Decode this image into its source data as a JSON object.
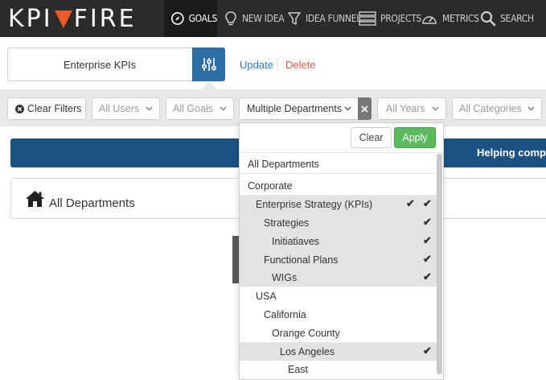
{
  "nav": {
    "logo_left": "KPI",
    "logo_right": "FIRE",
    "items": [
      {
        "label": "GOALS",
        "icon": "compass-icon",
        "active": true
      },
      {
        "label": "NEW IDEA",
        "icon": "lightbulb-icon"
      },
      {
        "label": "IDEA FUNNEL",
        "icon": "funnel-icon"
      },
      {
        "label": "PROJECTS",
        "icon": "projects-icon"
      },
      {
        "label": "METRICS",
        "icon": "speedometer-icon"
      },
      {
        "label": "SEARCH",
        "icon": "search-icon"
      }
    ]
  },
  "goal_bar": {
    "selected_goal": "Enterprise KPIs",
    "update_label": "Update",
    "delete_label": "Delete"
  },
  "filters": {
    "clear_filters_label": "Clear Filters",
    "users": "All Users",
    "goals": "All Goals",
    "departments": "Multiple Departments",
    "years": "All Years",
    "categories": "All Categories"
  },
  "banner": {
    "text": "Helping comp"
  },
  "department_card": {
    "title": "All Departments"
  },
  "dropdown": {
    "clear_label": "Clear",
    "apply_label": "Apply",
    "options": [
      {
        "label": "All Departments",
        "level": 0,
        "selected": false
      },
      {
        "label": "Corporate",
        "level": 0,
        "selected": false
      },
      {
        "label": "Enterprise Strategy (KPIs)",
        "level": 1,
        "selected": true
      },
      {
        "label": "Strategies",
        "level": 2,
        "selected": true
      },
      {
        "label": "Initiatiaves",
        "level": 3,
        "selected": true
      },
      {
        "label": "Functional Plans",
        "level": 2,
        "selected": true
      },
      {
        "label": "WIGs",
        "level": 3,
        "selected": true
      },
      {
        "label": "USA",
        "level": 0,
        "selected": false
      },
      {
        "label": "California",
        "level": 1,
        "selected": false
      },
      {
        "label": "Orange County",
        "level": 2,
        "selected": false
      },
      {
        "label": "Los Angeles",
        "level": 3,
        "selected": true
      },
      {
        "label": "East",
        "level": 4,
        "selected": false
      }
    ]
  },
  "colors": {
    "nav_bg": "#2b2b2b",
    "brand_blue": "#2f6ea4",
    "banner_blue": "#1b5282",
    "apply_green": "#5cb85c",
    "delete_red": "#e25a4a",
    "flame_orange": "#f05a28"
  }
}
